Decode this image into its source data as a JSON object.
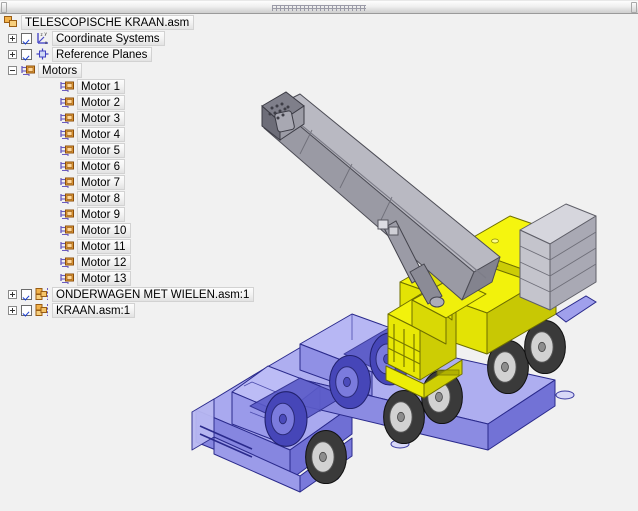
{
  "window": {
    "background_color": "#f1f1f1",
    "splitter": {
      "name": "horizontal-splitter-grip"
    }
  },
  "tree": {
    "root": {
      "label": "TELESCOPISCHE KRAAN.asm",
      "icon": "assembly-icon",
      "expander": "none",
      "checkbox": false
    },
    "items": [
      {
        "label": "Coordinate Systems",
        "icon": "coordinate-systems-icon",
        "expander": "plus",
        "checkbox": true,
        "depth": 1
      },
      {
        "label": "Reference Planes",
        "icon": "reference-planes-icon",
        "expander": "plus",
        "checkbox": true,
        "depth": 1
      },
      {
        "label": "Motors",
        "icon": "motor-icon",
        "expander": "minus",
        "checkbox": false,
        "depth": 1
      },
      {
        "label": "Motor 1",
        "icon": "motor-icon",
        "expander": "none",
        "checkbox": false,
        "depth": 2
      },
      {
        "label": "Motor 2",
        "icon": "motor-icon",
        "expander": "none",
        "checkbox": false,
        "depth": 2
      },
      {
        "label": "Motor 3",
        "icon": "motor-icon",
        "expander": "none",
        "checkbox": false,
        "depth": 2
      },
      {
        "label": "Motor 4",
        "icon": "motor-icon",
        "expander": "none",
        "checkbox": false,
        "depth": 2
      },
      {
        "label": "Motor 5",
        "icon": "motor-icon",
        "expander": "none",
        "checkbox": false,
        "depth": 2
      },
      {
        "label": "Motor 6",
        "icon": "motor-icon",
        "expander": "none",
        "checkbox": false,
        "depth": 2
      },
      {
        "label": "Motor 7",
        "icon": "motor-icon",
        "expander": "none",
        "checkbox": false,
        "depth": 2
      },
      {
        "label": "Motor 8",
        "icon": "motor-icon",
        "expander": "none",
        "checkbox": false,
        "depth": 2
      },
      {
        "label": "Motor 9",
        "icon": "motor-icon",
        "expander": "none",
        "checkbox": false,
        "depth": 2
      },
      {
        "label": "Motor 10",
        "icon": "motor-icon",
        "expander": "none",
        "checkbox": false,
        "depth": 2
      },
      {
        "label": "Motor 11",
        "icon": "motor-icon",
        "expander": "none",
        "checkbox": false,
        "depth": 2
      },
      {
        "label": "Motor 12",
        "icon": "motor-icon",
        "expander": "none",
        "checkbox": false,
        "depth": 2
      },
      {
        "label": "Motor 13",
        "icon": "motor-icon",
        "expander": "none",
        "checkbox": false,
        "depth": 2
      },
      {
        "label": "ONDERWAGEN MET WIELEN.asm:1",
        "icon": "sub-assembly-icon",
        "expander": "plus",
        "checkbox": true,
        "depth": 1
      },
      {
        "label": "KRAAN.asm:1",
        "icon": "sub-assembly-icon",
        "expander": "plus",
        "checkbox": true,
        "depth": 1
      }
    ]
  },
  "viewport": {
    "name": "3d-model-viewport",
    "model": "telescopic mobile crane",
    "colors": {
      "boom_light": "#b7b7c0",
      "boom_dark": "#8e8e99",
      "superstructure_yellow": "#f2f20c",
      "superstructure_yellow_dark": "#c9c905",
      "counterweight_gray": "#c8c8cf",
      "counterweight_gray_dark": "#a2a2ad",
      "chassis_light": "#b2b2f0",
      "chassis_dark": "#6a6ad0",
      "chassis_mid": "#8f8fe4",
      "tire_dark": "#3a3a3a",
      "rim_gray": "#cfcfcf",
      "outline": "#1a1a4a",
      "background": "#f1f1f1"
    }
  }
}
